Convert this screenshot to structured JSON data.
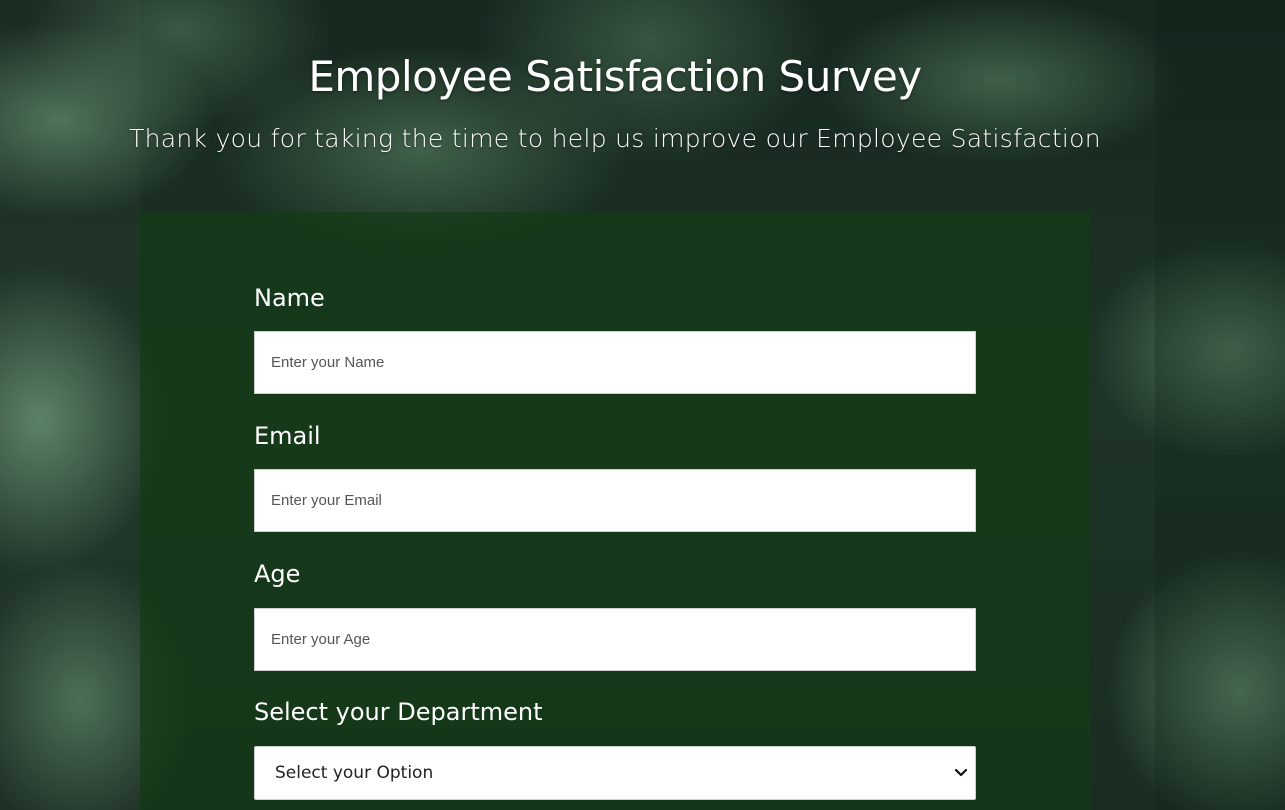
{
  "header": {
    "title": "Employee Satisfaction Survey",
    "subtitle": "Thank you for taking the time to help us improve our Employee Satisfaction"
  },
  "form": {
    "name": {
      "label": "Name",
      "placeholder": "Enter your Name"
    },
    "email": {
      "label": "Email",
      "placeholder": "Enter your Email"
    },
    "age": {
      "label": "Age",
      "placeholder": "Enter your Age"
    },
    "department": {
      "label": "Select your Department",
      "selected": "Select your Option"
    }
  },
  "icons": {
    "select_arrow": "chevron-down-icon"
  },
  "colors": {
    "panel": "#143c16",
    "text": "#ffffff",
    "input_bg": "#ffffff"
  }
}
